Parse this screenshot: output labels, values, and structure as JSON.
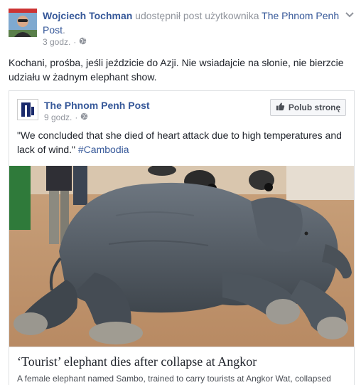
{
  "post": {
    "author": "Wojciech Tochman",
    "shared_text": "udostępnił post użytkownika",
    "shared_page": "The Phnom Penh Post",
    "shared_suffix": ".",
    "time": "3 godz.",
    "separator": "·",
    "privacy_icon": "globe-icon",
    "menu_icon": "chevron-down-icon",
    "message": "Kochani, prośba, jeśli jeździcie do Azji. Nie wsiadajcie na słonie, nie bierzcie udziału w żadnym elephant show."
  },
  "shared_post": {
    "page_name": "The Phnom Penh Post",
    "time": "9 godz.",
    "separator": "·",
    "like_button": "Polub stronę",
    "like_icon": "thumbs-up-icon",
    "quote": "\"We concluded that she died of heart attack due to high temperatures and lack of wind.\"",
    "hashtag": "#Cambodia"
  },
  "article": {
    "title": "‘Tourist’ elephant dies after collapse at Angkor",
    "description": "A female elephant named Sambo, trained to carry tourists at Angkor Wat, collapsed"
  },
  "colors": {
    "link": "#365899",
    "text": "#1d2129",
    "meta": "#90949c",
    "border": "#dddfe2"
  }
}
